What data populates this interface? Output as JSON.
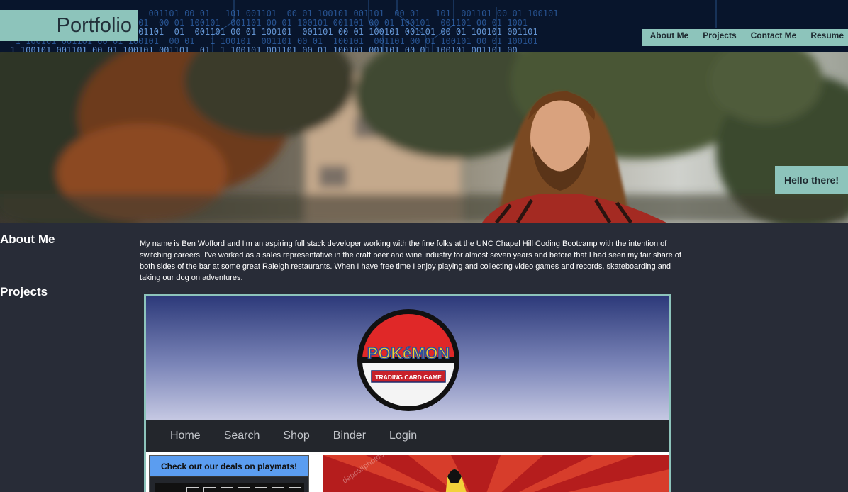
{
  "header": {
    "brand": "Portfolio",
    "nav": [
      "About Me",
      "Projects",
      "Contact Me",
      "Resume"
    ]
  },
  "hero": {
    "greeting": "Hello there!"
  },
  "about": {
    "title": "About Me",
    "text": "My name is Ben Wofford and I'm an aspiring full stack developer working with the fine folks at the UNC Chapel Hill Coding Bootcamp with the intention of switching careers. I've worked as a sales representative in the craft beer and wine industry for almost seven years and before that I had seen my fair share of both sides of the bar at some great Raleigh restaurants. When I have free time I enjoy playing and collecting video games and records, skateboarding and taking our dog on adventures."
  },
  "projects": {
    "title": "Projects",
    "screenshot": {
      "logo_main": "POKéMON",
      "logo_sub": "TRADING CARD GAME",
      "nav": [
        "Home",
        "Search",
        "Shop",
        "Binder",
        "Login"
      ],
      "deal_banner": "Check out our deals on playmats!",
      "watermark": "depositphotos"
    }
  },
  "colors": {
    "accent": "#8dc4bb",
    "background": "#282c37",
    "header_dark": "#08152c"
  }
}
